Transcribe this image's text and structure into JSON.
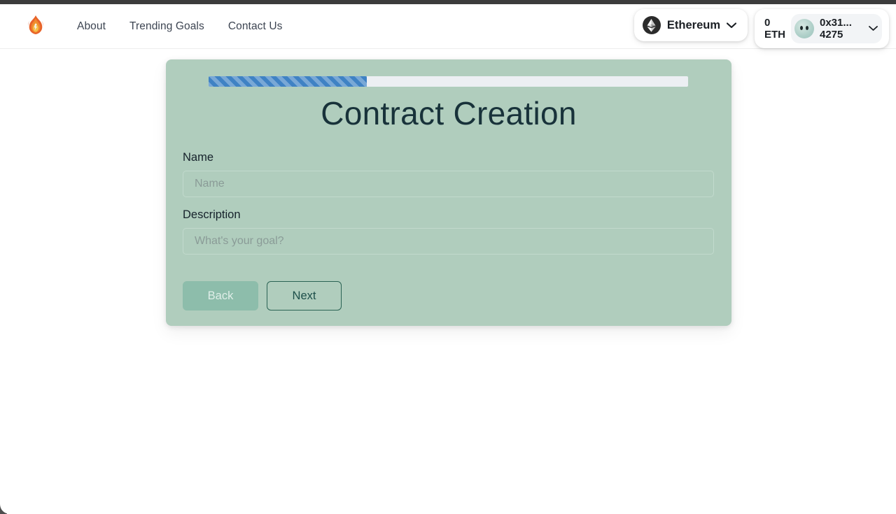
{
  "header": {
    "logo_icon": "flame-logo-icon",
    "nav": [
      {
        "label": "About"
      },
      {
        "label": "Trending Goals"
      },
      {
        "label": "Contact Us"
      }
    ],
    "chain_selector": {
      "icon": "ethereum-icon",
      "label": "Ethereum",
      "chevron": "⌄"
    },
    "account": {
      "balance": "0",
      "balance_unit": "ETH",
      "avatar_icon": "account-avatar-icon",
      "address_line1": "0x31...",
      "address_line2": "4275",
      "chevron": "⌄"
    }
  },
  "card": {
    "progress": {
      "percent": 33,
      "fill_color": "#3f82c4",
      "track_color": "#eceff3"
    },
    "title": "Contract Creation",
    "fields": [
      {
        "label": "Name",
        "placeholder": "Name",
        "value": ""
      },
      {
        "label": "Description",
        "placeholder": "What's your goal?",
        "value": ""
      }
    ],
    "buttons": {
      "back_label": "Back",
      "next_label": "Next"
    },
    "background_color": "#b0cdbd",
    "title_color": "#18323a"
  }
}
